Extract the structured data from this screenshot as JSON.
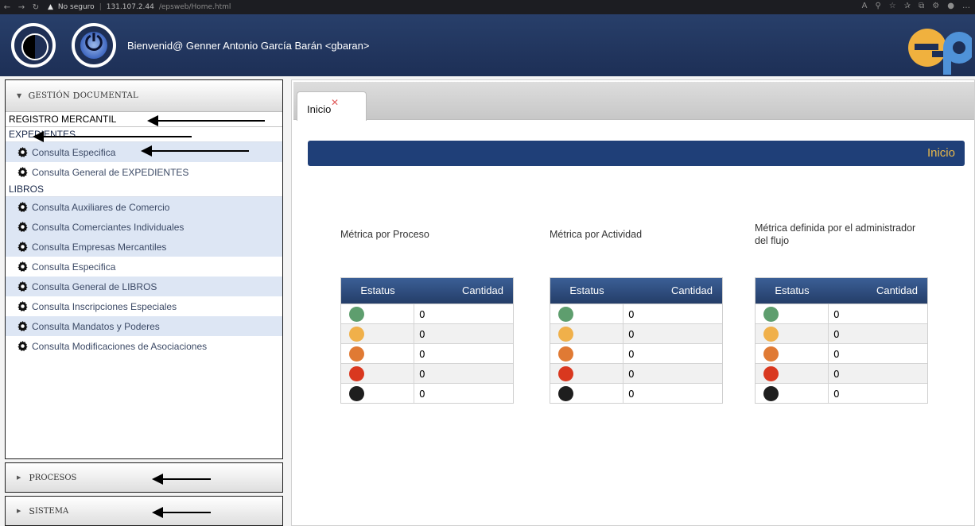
{
  "browser": {
    "security_label": "No seguro",
    "url_host": "131.107.2.44",
    "url_path": "/epsweb/Home.html"
  },
  "header": {
    "welcome": "Bienvenid@ Genner Antonio García Barán <gbaran>",
    "logo_text": "ep"
  },
  "sidebar": {
    "main_panel": {
      "title_initial_1": "G",
      "title_rest_1": "ESTIÓN",
      "title_initial_2": "D",
      "title_rest_2": "OCUMENTAL"
    },
    "group_label": "REGISTRO MERCANTIL",
    "sections": [
      {
        "label": "EXPEDIENTES",
        "items": [
          "Consulta Especifica",
          "Consulta General de EXPEDIENTES"
        ]
      },
      {
        "label": "LIBROS",
        "items": [
          "Consulta Auxiliares de Comercio",
          "Consulta Comerciantes Individuales",
          "Consulta Empresas Mercantiles",
          "Consulta Especifica",
          "Consulta General de LIBROS",
          "Consulta Inscripciones Especiales",
          "Consulta Mandatos y Poderes",
          "Consulta Modificaciones de Asociaciones"
        ]
      }
    ],
    "procesos": {
      "initial": "P",
      "rest": "ROCESOS"
    },
    "sistema": {
      "initial": "S",
      "rest": "ISTEMA"
    }
  },
  "content": {
    "tab_label": "Inicio",
    "banner_title": "Inicio",
    "metrics": [
      {
        "title": "Métrica por Proceso",
        "col_status": "Estatus",
        "col_count": "Cantidad",
        "values": [
          "0",
          "0",
          "0",
          "0",
          "0"
        ]
      },
      {
        "title": "Métrica por Actividad",
        "col_status": "Estatus",
        "col_count": "Cantidad",
        "values": [
          "0",
          "0",
          "0",
          "0",
          "0"
        ]
      },
      {
        "title": "Métrica definida por el administrador del flujo",
        "col_status": "Estatus",
        "col_count": "Cantidad",
        "values": [
          "0",
          "0",
          "0",
          "0",
          "0"
        ]
      }
    ],
    "status_colors": [
      "#5e9e6e",
      "#f0b04a",
      "#e07a34",
      "#d9381f",
      "#1e1e1e"
    ]
  },
  "colors": {
    "header_bg": "#1f3260",
    "banner_bg": "#1f3f78",
    "banner_text": "#e8b84a",
    "menu_alt_bg": "#dde6f4"
  }
}
